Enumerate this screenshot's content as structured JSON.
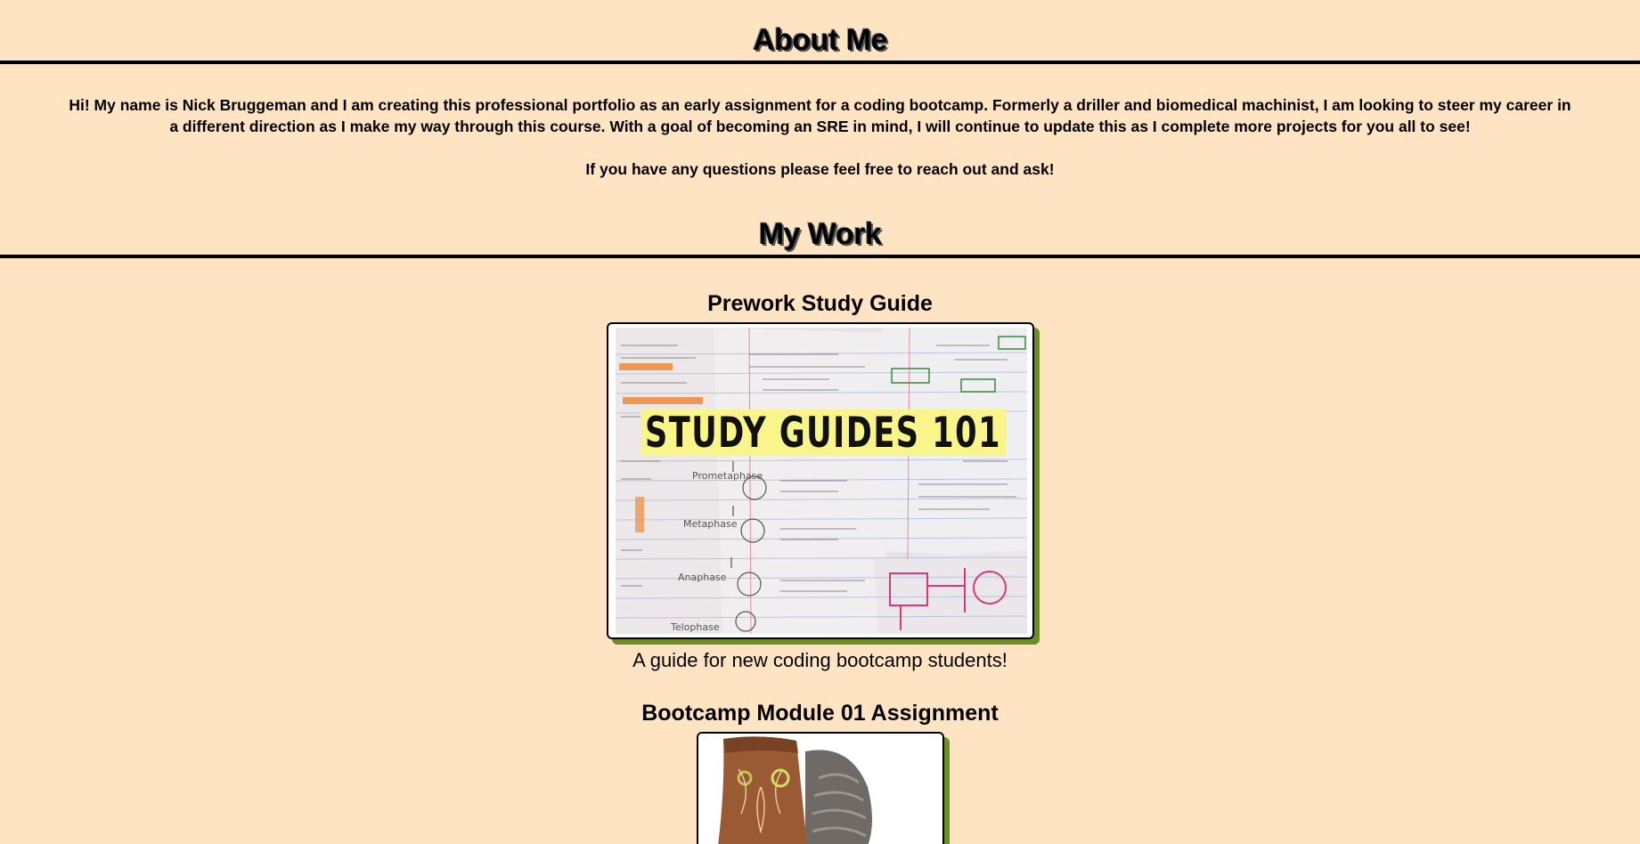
{
  "about": {
    "heading": "About Me",
    "paragraph_1": "Hi! My name is Nick Bruggeman and I am creating this professional portfolio as an early assignment for a coding bootcamp. Formerly a driller and biomedical machinist, I am looking to steer my career in a different direction as I make my way through this course. With a goal of becoming an SRE in mind, I will continue to update this as I complete more projects for you all to see!",
    "paragraph_2": "If you have any questions please feel free to reach out and ask!"
  },
  "work": {
    "heading": "My Work",
    "items": [
      {
        "title": "Prework Study Guide",
        "image_banner_text": "STUDY GUIDES 101",
        "description": "A guide for new coding bootcamp students!"
      },
      {
        "title": "Bootcamp Module 01 Assignment"
      }
    ]
  },
  "colors": {
    "background": "#ffe4c4",
    "card_shadow": "#6b8e23",
    "banner_highlight": "#f9f58a"
  }
}
